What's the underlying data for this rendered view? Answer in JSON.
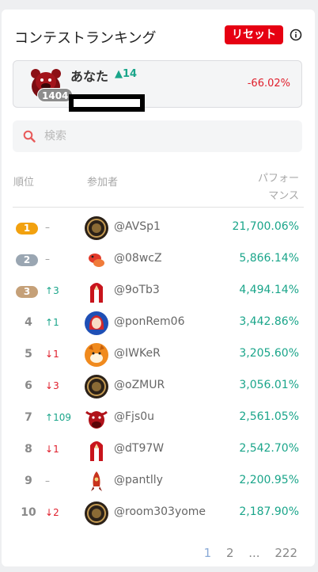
{
  "header": {
    "title": "コンテストランキング",
    "reset_label": "リセット",
    "info_icon": "info-icon"
  },
  "you": {
    "name": "あなた",
    "rank_change": "14",
    "rank": "1404",
    "performance": "-66.02%"
  },
  "search": {
    "placeholder": "検索",
    "value": ""
  },
  "columns": {
    "rank": "順位",
    "user": "参加者",
    "perf_line1": "パフォー",
    "perf_line2": "マンス"
  },
  "rows": [
    {
      "rank": "1",
      "delta": "–",
      "handle": "@AVSp1",
      "perf": "21,700.06%"
    },
    {
      "rank": "2",
      "delta": "–",
      "handle": "@08wcZ",
      "perf": "5,866.14%"
    },
    {
      "rank": "3",
      "delta": "3",
      "handle": "@9oTb3",
      "perf": "4,494.14%"
    },
    {
      "rank": "4",
      "delta": "1",
      "handle": "@ponRem06",
      "perf": "3,442.86%"
    },
    {
      "rank": "5",
      "delta": "1",
      "handle": "@IWKeR",
      "perf": "3,205.60%"
    },
    {
      "rank": "6",
      "delta": "3",
      "handle": "@oZMUR",
      "perf": "3,056.01%"
    },
    {
      "rank": "7",
      "delta": "109",
      "handle": "@Fjs0u",
      "perf": "2,561.05%"
    },
    {
      "rank": "8",
      "delta": "1",
      "handle": "@dT97W",
      "perf": "2,542.70%"
    },
    {
      "rank": "9",
      "delta": "–",
      "handle": "@pantlly",
      "perf": "2,200.95%"
    },
    {
      "rank": "10",
      "delta": "2",
      "handle": "@room303yome",
      "perf": "2,187.90%"
    }
  ],
  "pagination": {
    "p1": "1",
    "p2": "2",
    "ellipsis": "...",
    "last": "222"
  },
  "colors": {
    "accent_up": "#1aa58a",
    "accent_down": "#e01e2b",
    "reset": "#e60012",
    "gold": "#f2a10f",
    "silver": "#9aa6b2",
    "bronze": "#c5a078"
  }
}
